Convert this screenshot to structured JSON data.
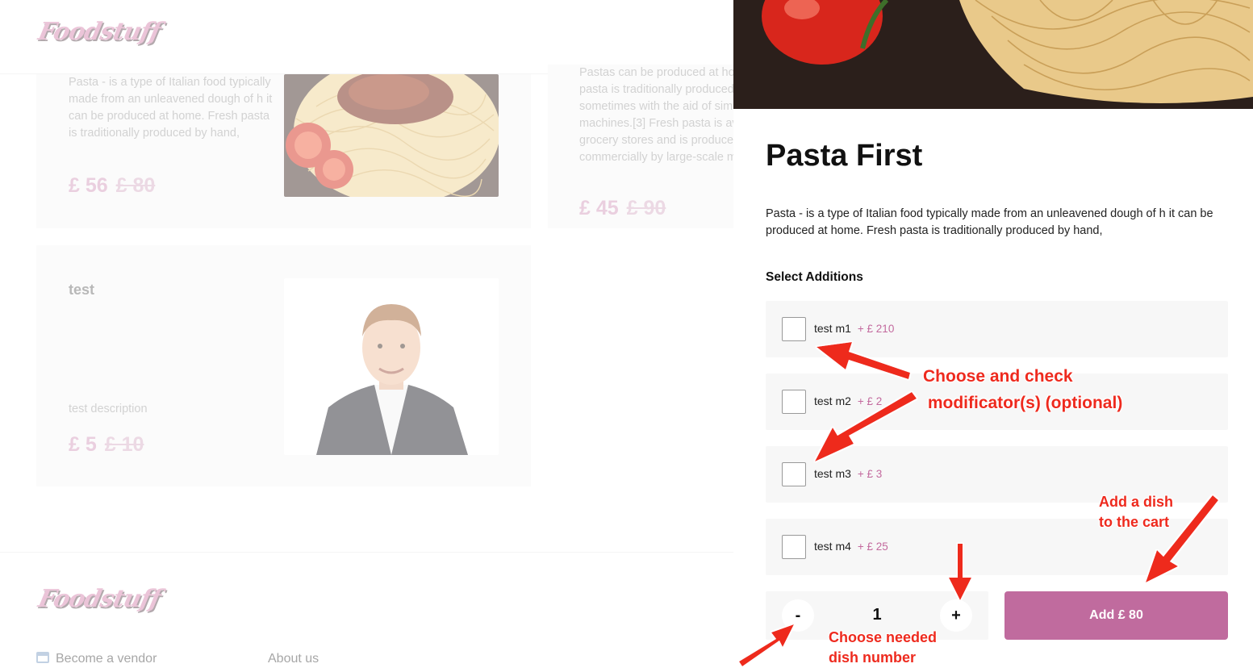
{
  "brand": {
    "logo_text": "Foodstuff"
  },
  "background": {
    "cards": [
      {
        "description": "Pasta - is a type of Italian food typically made from an unleavened dough of h it can be produced at home. Fresh pasta is traditionally produced by hand,",
        "price": "£ 56",
        "old_price": "£ 80"
      },
      {
        "description": "Pastas can be produced at home. Fresh pasta is traditionally produced by hand, sometimes with the aid of simple machines.[3] Fresh pasta is available in grocery stores and is produced commercially by large-scale machines.",
        "price": "£ 45",
        "old_price": "£ 90"
      },
      {
        "title": "test",
        "description": "test description",
        "price": "£ 5",
        "old_price": "£ 10"
      }
    ],
    "footer": {
      "links": [
        "Become a vendor",
        "About us"
      ]
    }
  },
  "modal": {
    "title": "Pasta First",
    "description": "Pasta - is a type of Italian food typically made from an unleavened dough of h it can be produced at home. Fresh pasta is traditionally produced by hand,",
    "additions_label": "Select Additions",
    "modifiers": [
      {
        "name": "test m1",
        "price": "+ £ 210",
        "checked": false
      },
      {
        "name": "test m2",
        "price": "+ £ 2",
        "checked": false
      },
      {
        "name": "test m3",
        "price": "+ £ 3",
        "checked": false
      },
      {
        "name": "test m4",
        "price": "+ £ 25",
        "checked": false
      }
    ],
    "quantity": {
      "minus_label": "-",
      "value": "1",
      "plus_label": "+"
    },
    "add_button_label": "Add £ 80"
  },
  "annotations": {
    "modifiers_note": "Choose and check\n modificator(s) (optional)",
    "cart_note": "Add a dish\nto the cart",
    "quantity_note": "Choose needed\ndish number",
    "color": "#ee2a1e"
  }
}
